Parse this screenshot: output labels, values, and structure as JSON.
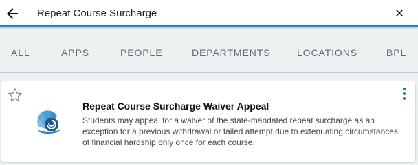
{
  "search": {
    "query": "Repeat Course Surcharge",
    "back_icon": "arrow-left-icon",
    "clear_icon": "close-icon",
    "accent_color": "#1f86c9"
  },
  "tabs": [
    {
      "label": "ALL"
    },
    {
      "label": "APPS"
    },
    {
      "label": "PEOPLE"
    },
    {
      "label": "DEPARTMENTS"
    },
    {
      "label": "LOCATIONS"
    },
    {
      "label": "BPL"
    }
  ],
  "results": [
    {
      "title": "Repeat Course Surcharge Waiver Appeal",
      "description": "Students may appeal for a waiver of the state-mandated repeat surcharge as an exception for a previous withdrawal or failed attempt due to extenuating circumstances of financial hardship only once for each course.",
      "favorite_icon": "star-outline-icon",
      "menu_icon": "more-vertical-icon",
      "logo_icon": "nautilus-shell-logo",
      "logo_color": "#1f86c9"
    }
  ]
}
